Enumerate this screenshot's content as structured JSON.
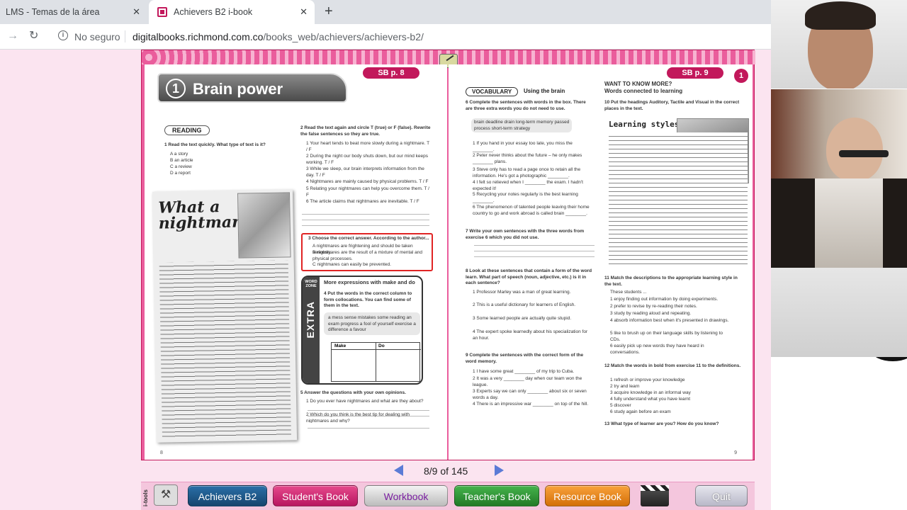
{
  "browser": {
    "tabs": [
      {
        "label": "LMS - Temas de la área",
        "close": "✕"
      },
      {
        "label": "Achievers B2 i-book",
        "close": "✕"
      }
    ],
    "new_tab": "+",
    "insecure_label": "No seguro",
    "url_host": "digitalbooks.richmond.com.co",
    "url_path": "/books_web/achievers/achievers-b2/"
  },
  "book": {
    "left_page": {
      "sb_badge": "SB p. 8",
      "unit_number": "1",
      "title": "Brain power",
      "section": "READING",
      "ex1": "1   Read the text quickly. What type of text is it?",
      "ex1_options": [
        "A  a story",
        "B  an article",
        "C  a review",
        "D  a report"
      ],
      "magazine_title": "What a nightmare!",
      "ex2": "2   Read the text again and circle T (true) or F (false). Rewrite the false sentences so they are true.",
      "ex2_items": [
        "1  Your heart tends to beat more slowly during a nightmare.   T / F",
        "2  During the night our body shuts down, but our mind keeps working.   T / F",
        "3  While we sleep, our brain interprets information from the day.   T / F",
        "4  Nightmares are mainly caused by physical problems.   T / F",
        "5  Relating your nightmares can help you overcome them.   T / F",
        "6  The article claims that nightmares are inevitable.   T / F"
      ],
      "ex3": "3   Choose the correct answer. According to the author...",
      "ex3_options": [
        "A  nightmares are frightening and should be taken seriously.",
        "B  nightmares are the result of a mixture of mental and physical processes.",
        "C  nightmares can easily be prevented."
      ],
      "extra_label": "EXTRA",
      "word_zone": "WORD ZONE",
      "extra_title": "More expressions with make and do",
      "ex4": "4   Put the words in the correct column to form collocations. You can find some of them in the text.",
      "ex4_words": "a mess   sense   mistakes   some reading   an exam   progress   a fool of yourself   exercise   a difference   a favour",
      "table_headers": [
        "Make",
        "Do"
      ],
      "ex5": "5   Answer the questions with your own opinions.",
      "ex5_items": [
        "1  Do you ever have nightmares and what are they about?",
        "2  Which do you think is the best tip for dealing with nightmares and why?"
      ],
      "page_number": "8"
    },
    "right_page": {
      "sb_badge": "SB p. 9",
      "corner_number": "1",
      "vocab_label": "VOCABULARY",
      "vocab_sub": "Using the brain",
      "ex6": "6   Complete the sentences with words in the box. There are three extra words you do not need to use.",
      "ex6_words": "brain   deadline   drain   long-term   memory   passed   process   short-term   strategy",
      "ex6_items": [
        "1  If you hand in your essay too late, you miss the ________.",
        "2  Peter never thinks about the future – he only makes ________ plans.",
        "3  Steve only has to read a page once to retain all the information. He's got a photographic ________.",
        "4  I felt so relieved when I ________ the exam. I hadn't expected it!",
        "5  Recycling your notes regularly is the best learning ________.",
        "6  The phenomenon of talented people leaving their home country to go and work abroad is called brain ________."
      ],
      "ex7": "7   Write your own sentences with the three words from exercise 6 which you did not use.",
      "ex8": "8   Look at these sentences that contain a form of the word learn. What part of speech (noun, adjective, etc.) is it in each sentence?",
      "ex8_items": [
        "1  Professor Marley was a man of great learning.",
        "2  This is a useful dictionary for learners of English.",
        "3  Some learned people are actually quite stupid.",
        "4  The expert spoke learnedly about his specialization for an hour."
      ],
      "ex9": "9   Complete the sentences with the correct form of the word memory.",
      "ex9_items": [
        "1  I have some great ________ of my trip to Cuba.",
        "2  It was a very ________ day when our team won the league.",
        "3  Experts say we can only ________ about six or seven words a day.",
        "4  There is an impressive war ________ on top of the hill."
      ],
      "want_to_know": "WANT TO KNOW MORE?",
      "want_to_know_sub": "Words connected to learning",
      "ex10": "10  Put the headings Auditory, Tactile and Visual in the correct places in the text.",
      "learning_styles_title": "Learning styles",
      "ex11": "11  Match the descriptions to the appropriate learning style in the text.",
      "ex11_items": [
        "These students ...",
        "1  enjoy finding out information by doing experiments.",
        "2  prefer to revise by re-reading their notes.",
        "3  study by reading aloud and repeating.",
        "4  absorb information best when it's presented in drawings.",
        "5  like to brush up on their language skills by listening to CDs.",
        "6  easily pick up new words they have heard in conversations."
      ],
      "ex12": "12  Match the words in bold from exercise 11 to the definitions.",
      "ex12_items": [
        "1  refresh or improve your knowledge",
        "2  try and learn",
        "3  acquire knowledge in an informal way",
        "4  fully understand what you have learnt",
        "5  discover",
        "6  study again before an exam"
      ],
      "ex13": "13  What type of learner are you? How do you know?",
      "page_number": "9"
    }
  },
  "pager": {
    "label": "8/9 of 145"
  },
  "toolbar": {
    "itools": "i-tools",
    "buttons": {
      "achievers": "Achievers B2",
      "students_book": "Student's Book",
      "workbook": "Workbook",
      "teachers_book": "Teacher's Book",
      "resource_book": "Resource Book",
      "quit": "Quit"
    }
  }
}
